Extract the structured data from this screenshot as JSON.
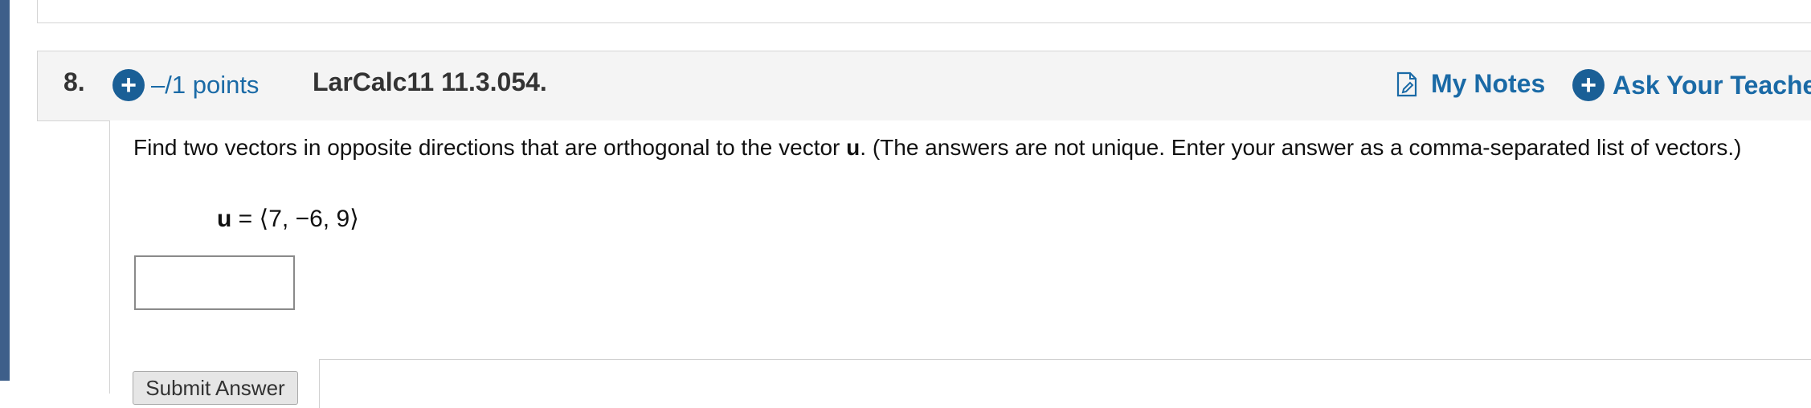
{
  "question": {
    "number": "8.",
    "points_label": "–/1 points",
    "reference": "LarCalc11 11.3.054.",
    "my_notes_label": "My Notes",
    "ask_teacher_label": "Ask Your Teacher",
    "prompt_part1": "Find two vectors in opposite directions that are orthogonal to the vector ",
    "prompt_bold": "u",
    "prompt_part2": ". (The answers are not unique. Enter your answer as a comma-separated list of vectors.)",
    "vector_symbol": "u",
    "vector_equals": " = ",
    "vector_value": "⟨7, −6, 9⟩",
    "answer_value": "",
    "submit_label": "Submit Answer"
  },
  "colors": {
    "link": "#1a6aa6",
    "icon_fill": "#1a5f96",
    "left_strip": "#3e5f8a",
    "header_bg": "#f4f4f4"
  },
  "icons": {
    "points_icon": "plus-circle-icon",
    "notes_icon": "document-edit-icon",
    "ask_icon": "plus-circle-icon"
  }
}
